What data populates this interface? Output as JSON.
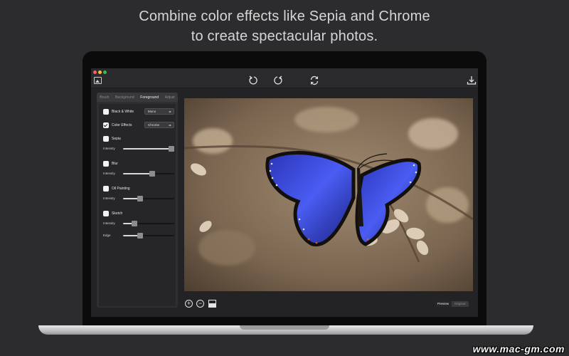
{
  "headline": {
    "line1": "Combine color effects like Sepia and Chrome",
    "line2": "to create spectacular photos."
  },
  "toolbar": {
    "app_icon": "photo-icon",
    "undo_icon": "rotate-left-icon",
    "redo_icon": "rotate-right-icon",
    "refresh_icon": "refresh-icon",
    "download_icon": "download-icon"
  },
  "sidebar": {
    "tabs": [
      {
        "label": "Brush",
        "active": false
      },
      {
        "label": "Background",
        "active": false
      },
      {
        "label": "Foreground",
        "active": true
      },
      {
        "label": "Adjust",
        "active": false
      }
    ],
    "options": [
      {
        "label": "Black & White",
        "checked": false,
        "select": "Mono"
      },
      {
        "label": "Color Effects",
        "checked": true,
        "select": "Chrome"
      },
      {
        "label": "Sepia",
        "checked": false
      },
      {
        "label": "Blur",
        "checked": false
      },
      {
        "label": "Oil Painting",
        "checked": false
      },
      {
        "label": "Sketch",
        "checked": false
      }
    ],
    "sliders": [
      {
        "label": "Intensity",
        "value": 0.95
      },
      {
        "label": "Intensity",
        "value": 0.57
      },
      {
        "label": "Intensity",
        "value": 0.34
      },
      {
        "label": "Intensity",
        "value": 0.22
      },
      {
        "label": "Edge",
        "value": 0.34
      }
    ]
  },
  "bottom": {
    "zoom_in": "+",
    "zoom_out": "−",
    "preview": "Preview",
    "original": "Original"
  },
  "watermark": "www.mac-gm.com",
  "colors": {
    "accent_butterfly": "#3b4fe0",
    "sepia_background": "#8a7560"
  }
}
